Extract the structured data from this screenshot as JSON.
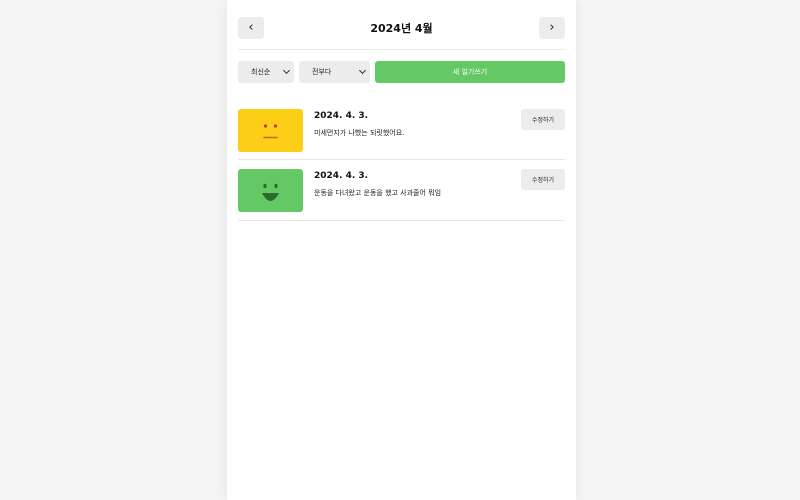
{
  "header": {
    "prev_label": "‹",
    "next_label": "›",
    "title": "2024년 4월"
  },
  "controls": {
    "sort_value": "최신순",
    "filter_value": "전부다",
    "new_button_label": "새 일기쓰기"
  },
  "diary_items": [
    {
      "date": "2024. 4. 3.",
      "content": "미세먼지가 나빴는 되릿했어요.",
      "emotion": "neutral",
      "color": "#fdce17",
      "edit_label": "수정하기"
    },
    {
      "date": "2024. 4. 3.",
      "content": "운동을 다녀왔고 운동을 했고 사과줄어 뭐임",
      "emotion": "happy",
      "color": "#64c964",
      "edit_label": "수정하기"
    }
  ],
  "colors": {
    "accent_green": "#64c964",
    "neutral_yellow": "#fdce17",
    "button_gray": "#ececec"
  }
}
